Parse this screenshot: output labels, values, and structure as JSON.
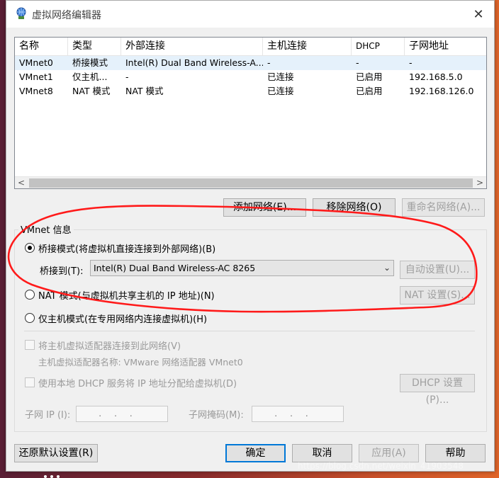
{
  "window": {
    "title": "虚拟网络编辑器",
    "close_glyph": "✕"
  },
  "table": {
    "headers": [
      "名称",
      "类型",
      "外部连接",
      "主机连接",
      "DHCP",
      "子网地址"
    ],
    "rows": [
      [
        "VMnet0",
        "桥接模式",
        "Intel(R) Dual Band Wireless-A...",
        "-",
        "-",
        "-"
      ],
      [
        "VMnet1",
        "仅主机...",
        "-",
        "已连接",
        "已启用",
        "192.168.5.0"
      ],
      [
        "VMnet8",
        "NAT 模式",
        "NAT 模式",
        "已连接",
        "已启用",
        "192.168.126.0"
      ]
    ],
    "selected_row": 0,
    "scroll_left": "<",
    "scroll_right": ">"
  },
  "list_buttons": {
    "add": "添加网络(E)...",
    "remove": "移除网络(O)",
    "rename": "重命名网络(A)..."
  },
  "vmnet_info": {
    "title": "VMnet 信息",
    "bridge_label": "桥接模式(将虚拟机直接连接到外部网络)(B)",
    "bridge_to_label": "桥接到(T):",
    "bridge_to_value": "Intel(R) Dual Band Wireless-AC 8265",
    "auto_settings": "自动设置(U)...",
    "nat_label": "NAT 模式(与虚拟机共享主机的 IP 地址)(N)",
    "nat_settings": "NAT 设置(S)...",
    "hostonly_label": "仅主机模式(在专用网络内连接虚拟机)(H)",
    "selected_mode": "bridge",
    "connect_adapter_label": "将主机虚拟适配器连接到此网络(V)",
    "adapter_name_label": "主机虚拟适配器名称: VMware 网络适配器 VMnet0",
    "dhcp_label": "使用本地 DHCP 服务将 IP 地址分配给虚拟机(D)",
    "dhcp_settings": "DHCP 设置(P)...",
    "subnet_ip_label": "子网 IP (I):",
    "subnet_ip_value": "...",
    "subnet_mask_label": "子网掩码(M):",
    "subnet_mask_value": "..."
  },
  "footer": {
    "restore": "还原默认设置(R)",
    "ok": "确定",
    "cancel": "取消",
    "apply": "应用(A)",
    "help": "帮助"
  },
  "watermark": "https://blog.csdn.net/weixin_41903548",
  "annotation_color": "#ff1a1a"
}
